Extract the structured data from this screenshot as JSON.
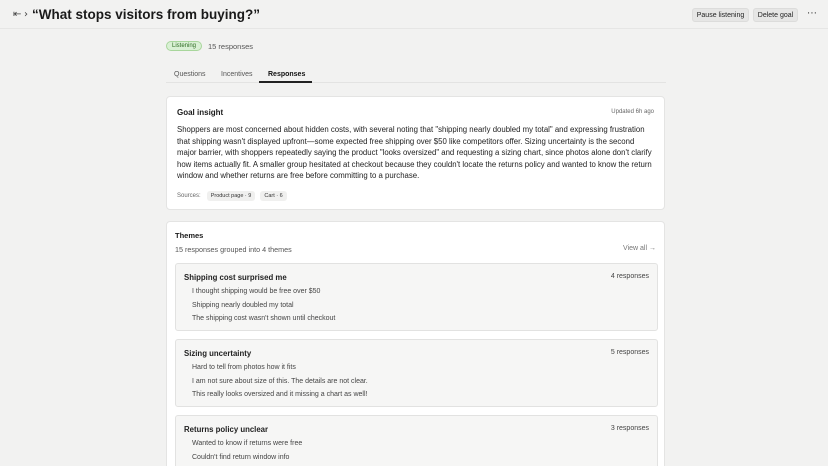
{
  "header": {
    "title": "“What stops visitors from buying?”",
    "pause_label": "Pause listening",
    "delete_label": "Delete goal",
    "more_icon": "more-icon"
  },
  "status": {
    "badge": "Listening",
    "responses": "15 responses"
  },
  "tabs": [
    {
      "label": "Questions"
    },
    {
      "label": "Incentives"
    },
    {
      "label": "Responses"
    }
  ],
  "goal_insight": {
    "title": "Goal insight",
    "updated": "Updated 6h ago",
    "body": "Shoppers are most concerned about hidden costs, with several noting that \"shipping nearly doubled my total\" and expressing frustration that shipping wasn't displayed upfront—some expected free shipping over $50 like competitors offer. Sizing uncertainty is the second major barrier, with shoppers repeatedly saying the product \"looks oversized\" and requesting a sizing chart, since photos alone don't clarify how items actually fit. A smaller group hesitated at checkout because they couldn't locate the returns policy and wanted to know the return window and whether returns are free before committing to a purchase.",
    "sources_label": "Sources:",
    "sources": [
      "Product page · 9",
      "Cart · 6"
    ]
  },
  "themes": {
    "title": "Themes",
    "subtitle": "15 responses grouped into 4 themes",
    "view_all": "View all →",
    "items": [
      {
        "name": "Shipping cost surprised me",
        "count": "4 responses",
        "quotes": [
          "I thought shipping would be free over $50",
          "Shipping nearly doubled my total",
          "The shipping cost wasn't shown until checkout"
        ]
      },
      {
        "name": "Sizing uncertainty",
        "count": "5 responses",
        "quotes": [
          "Hard to tell from photos how it fits",
          "I am not sure about size of this. The details are not clear.",
          "This really looks oversized and it missing a chart as well!"
        ]
      },
      {
        "name": "Returns policy unclear",
        "count": "3 responses",
        "quotes": [
          "Wanted to know if returns were free",
          "Couldn't find return window info"
        ]
      }
    ]
  },
  "colors": {
    "background": "#f2f2f1",
    "badge_bg": "#d9f0d4",
    "badge_text": "#2d6b22"
  }
}
